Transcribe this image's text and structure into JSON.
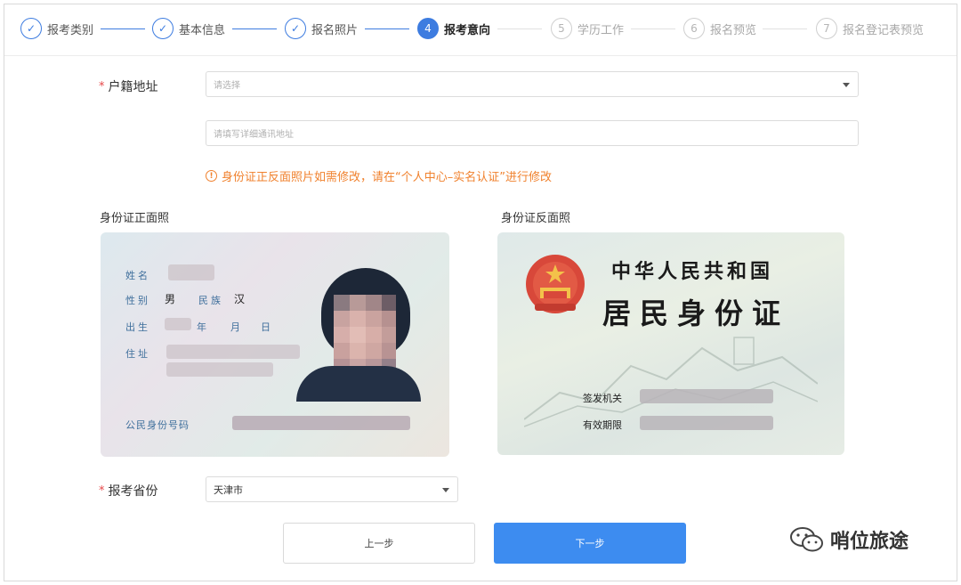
{
  "stepper": {
    "steps": [
      {
        "number": "1",
        "label": "报考类别",
        "status": "done"
      },
      {
        "number": "2",
        "label": "基本信息",
        "status": "done"
      },
      {
        "number": "3",
        "label": "报名照片",
        "status": "done"
      },
      {
        "number": "4",
        "label": "报考意向",
        "status": "active"
      },
      {
        "number": "5",
        "label": "学历工作",
        "status": "todo"
      },
      {
        "number": "6",
        "label": "报名预览",
        "status": "todo"
      },
      {
        "number": "7",
        "label": "报名登记表预览",
        "status": "todo"
      }
    ]
  },
  "form": {
    "required_mark": "*",
    "household": {
      "label": "户籍地址",
      "select_placeholder": "请选择",
      "detail_placeholder": "请填写详细通讯地址"
    },
    "notice": "身份证正反面照片如需修改，请在“个人中心–实名认证”进行修改",
    "notice_icon": "!",
    "id_front_title": "身份证正面照",
    "id_back_title": "身份证反面照",
    "province": {
      "label": "报考省份",
      "value": "天津市"
    }
  },
  "id_front": {
    "name_label": "姓名",
    "gender_label": "性别",
    "gender_value": "男",
    "ethnicity_label": "民族",
    "ethnicity_value": "汉",
    "birth_label": "出生",
    "year_label": "年",
    "month_label": "月",
    "day_label": "日",
    "address_label": "住址",
    "id_number_label": "公民身份号码"
  },
  "id_back": {
    "title_line1": "中华人民共和国",
    "title_line2": "居民身份证",
    "issuer_label": "签发机关",
    "validity_label": "有效期限"
  },
  "buttons": {
    "prev": "上一步",
    "next": "下一步"
  },
  "watermark": {
    "text": "哨位旅途",
    "icon": "wechat-icon"
  },
  "colors": {
    "primary": "#3d7ce0",
    "button_primary": "#3d8cf0",
    "warning": "#f0812d",
    "required": "#e6494a"
  }
}
